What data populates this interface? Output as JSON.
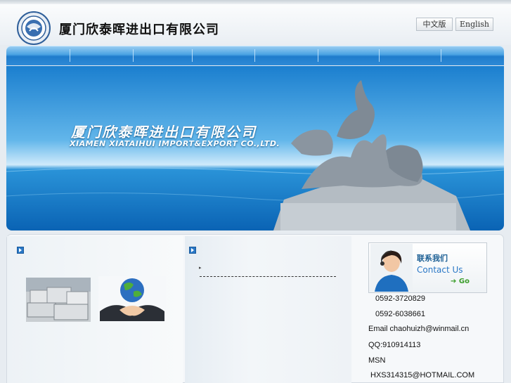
{
  "header": {
    "company_name": "厦门欣泰晖进出口有限公司",
    "lang_cn": "中文版",
    "lang_en": "English"
  },
  "banner": {
    "title": "厦门欣泰晖进出口有限公司",
    "subtitle": "XIAMEN XIATAIHUI IMPORT&EXPORT CO.,LTD."
  },
  "contact": {
    "title_cn": "联系我们",
    "title_en": "Contact Us",
    "go": "Go",
    "phone1": "0592-3720829",
    "phone2": "0592-6038661",
    "email": "Email chaohuizh@winmail.cn",
    "qq": "QQ:910914113",
    "msn_label": "MSN",
    "msn": "HXS314315@HOTMAIL.COM"
  },
  "colors": {
    "nav_blue": "#2e8ad6",
    "sea_blue": "#1f8fd6",
    "contact_title": "#1c5f94",
    "go_green": "#3a9d2a"
  }
}
